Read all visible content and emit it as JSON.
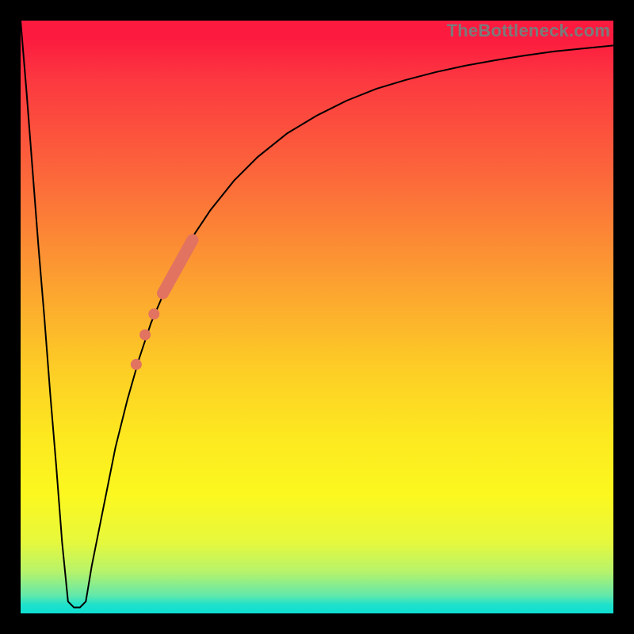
{
  "watermark": "TheBottleneck.com",
  "chart_data": {
    "type": "line",
    "title": "",
    "xlabel": "",
    "ylabel": "",
    "xlim": [
      0,
      100
    ],
    "ylim": [
      0,
      100
    ],
    "grid": false,
    "series": [
      {
        "name": "bottleneck-curve",
        "color": "#000000",
        "stroke_width": 2,
        "x": [
          0,
          1,
          2,
          3,
          4,
          5,
          6,
          7,
          8,
          9,
          10,
          11,
          12,
          14,
          16,
          18,
          20,
          22,
          25,
          28,
          32,
          36,
          40,
          45,
          50,
          55,
          60,
          65,
          70,
          75,
          80,
          85,
          90,
          95,
          100
        ],
        "y": [
          100,
          88,
          75,
          62,
          50,
          37,
          25,
          12,
          2,
          1,
          1,
          2,
          8,
          18,
          28,
          36,
          43,
          49,
          56,
          62,
          68,
          73,
          77,
          81,
          84,
          86.5,
          88.5,
          90,
          91.3,
          92.4,
          93.3,
          94.1,
          94.8,
          95.3,
          95.8
        ]
      }
    ],
    "markers": {
      "name": "highlighted-segment",
      "color": "#e27360",
      "thick_segment": {
        "x": [
          24,
          29
        ],
        "y": [
          54,
          63
        ],
        "width": 15
      },
      "dots": [
        {
          "x": 22.5,
          "y": 50.5,
          "r": 7
        },
        {
          "x": 21.0,
          "y": 47.0,
          "r": 7
        },
        {
          "x": 19.5,
          "y": 42.0,
          "r": 7
        }
      ]
    },
    "background_gradient": {
      "stops": [
        {
          "pct": 0,
          "color": "#fc1b3f"
        },
        {
          "pct": 45,
          "color": "#fca330"
        },
        {
          "pct": 80,
          "color": "#fcf81f"
        },
        {
          "pct": 100,
          "color": "#0ddfd3"
        }
      ]
    }
  }
}
